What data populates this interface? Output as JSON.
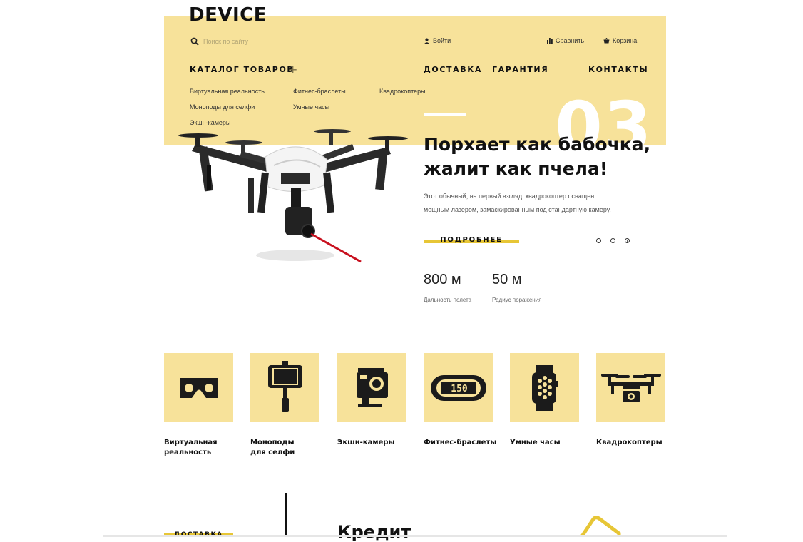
{
  "header": {
    "logo": "DEVICE",
    "search_placeholder": "Поиск по сайту",
    "login": "Войти",
    "compare": "Сравнить",
    "cart": "Корзина"
  },
  "nav": {
    "catalog": "КАТАЛОГ ТОВАРОВ",
    "delivery": "ДОСТАВКА",
    "warranty": "ГАРАНТИЯ",
    "contacts": "КОНТАКТЫ",
    "submenu": [
      "Виртуальная реальность",
      "Фитнес-браслеты",
      "Квадрокоптеры",
      "Моноподы для селфи",
      "Умные часы",
      "Экшн-камеры"
    ]
  },
  "slider": {
    "number": "03",
    "title_line1": "Порхает как бабочка,",
    "title_line2": "жалит как пчела!",
    "text_line1": "Этот обычный, на первый взгляд, квадрокоптер оснащен",
    "text_line2": "мощным лазером, замаскированным под стандартную камеру.",
    "more_label": "ПОДРОБНЕЕ",
    "active_slide": 3,
    "stats": [
      {
        "value": "800 м",
        "label": "Дальность полета"
      },
      {
        "value": "50 м",
        "label": "Радиус поражения"
      }
    ]
  },
  "categories": [
    {
      "line1": "Виртуальная",
      "line2": "реальность",
      "icon": "vr-headset-icon"
    },
    {
      "line1": "Моноподы",
      "line2": "для селфи",
      "icon": "selfie-stick-icon"
    },
    {
      "line1": "Экшн-камеры",
      "line2": "",
      "icon": "action-camera-icon"
    },
    {
      "line1": "Фитнес-браслеты",
      "line2": "",
      "icon": "fitness-band-icon",
      "band_text": "150"
    },
    {
      "line1": "Умные часы",
      "line2": "",
      "icon": "smartwatch-icon"
    },
    {
      "line1": "Квадрокоптеры",
      "line2": "",
      "icon": "quadcopter-icon"
    }
  ],
  "services": {
    "delivery_tab": "ДОСТАВКА",
    "credit_title": "Кредит"
  },
  "colors": {
    "accent": "#f7e29a",
    "accent_strong": "#e7c636",
    "text": "#111111"
  }
}
